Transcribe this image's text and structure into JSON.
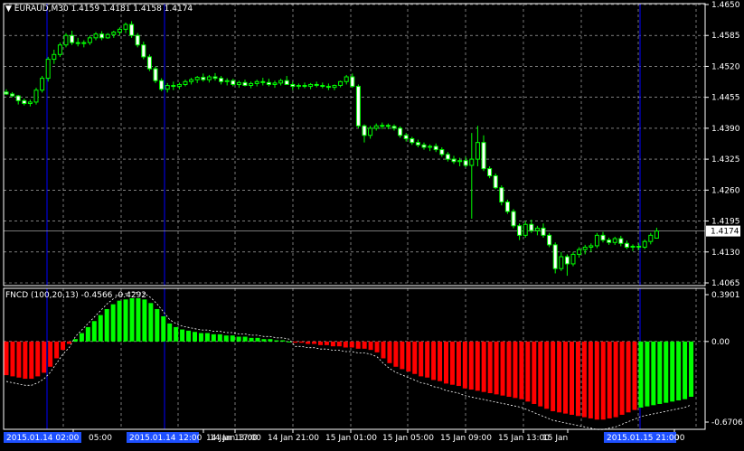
{
  "main_panel": {
    "symbol": "EURAUD,M30",
    "ohlc": "1.4159 1.4181 1.4158 1.4174",
    "current_price": "1.4174",
    "price_ticks": [
      "1.4650",
      "1.4585",
      "1.4520",
      "1.4455",
      "1.4390",
      "1.4325",
      "1.4260",
      "1.4195",
      "1.4130",
      "1.4065"
    ]
  },
  "indicator_panel": {
    "title": "FNCD (100,20,13) -0.4566 -0.4292",
    "ticks": [
      "0.3901",
      "0.00",
      "-0.6706"
    ]
  },
  "time_axis": {
    "labels": [
      "14 Jan 05:00",
      "14 Jan 13:00",
      "14 Jan 17:00",
      "14 Jan 21:00",
      "15 Jan 01:00",
      "15 Jan 05:00",
      "15 Jan 09:00",
      "15 Jan 13:00",
      "15 Jan",
      "00"
    ],
    "highlighted_labels": [
      "2015.01.14 02:00",
      "2015.01.14 12:00",
      "2015.01.15 21:00"
    ]
  },
  "colors": {
    "bull": "#00ff00",
    "bear": "#ff0000",
    "grid": "#c8c8c8",
    "vline": "#0000ff",
    "hilite": "#1e50ff"
  },
  "chart_data": [
    {
      "type": "candlestick",
      "title": "EURAUD,M30",
      "ylim": [
        1.4065,
        1.465
      ],
      "x": [
        "",
        "",
        "",
        "",
        "",
        "",
        "",
        "",
        "",
        "",
        "",
        "",
        "",
        "",
        "",
        "",
        "",
        "",
        "",
        "",
        "",
        "",
        "",
        "",
        "",
        "",
        "",
        "",
        "",
        "",
        "",
        "",
        "",
        "",
        "",
        "",
        "",
        "",
        "",
        "",
        "",
        "",
        "",
        "",
        "",
        "",
        "",
        "",
        "",
        "",
        "",
        "",
        "",
        "",
        "",
        "",
        "",
        "",
        "",
        "",
        "",
        "",
        "",
        "",
        "",
        "",
        "",
        "",
        "",
        "",
        "",
        "",
        "",
        "",
        "",
        "",
        "",
        "",
        "",
        "",
        "",
        "",
        "",
        "",
        "",
        "",
        "",
        "",
        "",
        "",
        "",
        "",
        "",
        "",
        "",
        "",
        "",
        "",
        "",
        "",
        "",
        "",
        "",
        "",
        "",
        "",
        "",
        "",
        "",
        "",
        "",
        "",
        "",
        "",
        "",
        "",
        "",
        "",
        "",
        "",
        "",
        "",
        "",
        "",
        "",
        "",
        "",
        "",
        ""
      ],
      "ohlc": [
        [
          1.4466,
          1.4472,
          1.446,
          1.4462
        ],
        [
          1.4462,
          1.4466,
          1.4455,
          1.4458
        ],
        [
          1.4458,
          1.446,
          1.444,
          1.4448
        ],
        [
          1.4448,
          1.4452,
          1.4438,
          1.4442
        ],
        [
          1.4442,
          1.445,
          1.4436,
          1.4445
        ],
        [
          1.4445,
          1.4475,
          1.444,
          1.447
        ],
        [
          1.447,
          1.45,
          1.4465,
          1.4495
        ],
        [
          1.4495,
          1.454,
          1.4488,
          1.4535
        ],
        [
          1.4535,
          1.4555,
          1.4525,
          1.4545
        ],
        [
          1.4545,
          1.457,
          1.454,
          1.4565
        ],
        [
          1.4565,
          1.459,
          1.456,
          1.4585
        ],
        [
          1.4585,
          1.4595,
          1.4565,
          1.457
        ],
        [
          1.457,
          1.458,
          1.4562,
          1.4568
        ],
        [
          1.4568,
          1.4575,
          1.456,
          1.457
        ],
        [
          1.457,
          1.4585,
          1.4565,
          1.458
        ],
        [
          1.458,
          1.4592,
          1.4575,
          1.4588
        ],
        [
          1.4588,
          1.4594,
          1.4575,
          1.458
        ],
        [
          1.458,
          1.459,
          1.4578,
          1.4587
        ],
        [
          1.4587,
          1.4595,
          1.458,
          1.4592
        ],
        [
          1.4592,
          1.4602,
          1.4585,
          1.4598
        ],
        [
          1.4598,
          1.4612,
          1.459,
          1.4608
        ],
        [
          1.4608,
          1.4615,
          1.458,
          1.4585
        ],
        [
          1.4585,
          1.459,
          1.456,
          1.4565
        ],
        [
          1.4565,
          1.4572,
          1.4535,
          1.454
        ],
        [
          1.454,
          1.4545,
          1.451,
          1.4515
        ],
        [
          1.4515,
          1.452,
          1.4485,
          1.449
        ],
        [
          1.449,
          1.4495,
          1.4468,
          1.4472
        ],
        [
          1.4472,
          1.4485,
          1.4465,
          1.448
        ],
        [
          1.448,
          1.4488,
          1.447,
          1.4478
        ],
        [
          1.4478,
          1.4486,
          1.4472,
          1.4482
        ],
        [
          1.4482,
          1.4492,
          1.4478,
          1.4488
        ],
        [
          1.4488,
          1.4496,
          1.4482,
          1.4492
        ],
        [
          1.4492,
          1.45,
          1.4485,
          1.4497
        ],
        [
          1.4497,
          1.4505,
          1.4488,
          1.4492
        ],
        [
          1.4492,
          1.4502,
          1.4486,
          1.4498
        ],
        [
          1.4498,
          1.4506,
          1.449,
          1.4495
        ],
        [
          1.4495,
          1.45,
          1.4482,
          1.4488
        ],
        [
          1.4488,
          1.4495,
          1.448,
          1.449
        ],
        [
          1.449,
          1.4494,
          1.4478,
          1.4482
        ],
        [
          1.4482,
          1.449,
          1.4475,
          1.4486
        ],
        [
          1.4486,
          1.4492,
          1.4478,
          1.448
        ],
        [
          1.448,
          1.4488,
          1.4474,
          1.4484
        ],
        [
          1.4484,
          1.4492,
          1.4478,
          1.4488
        ],
        [
          1.4488,
          1.4496,
          1.448,
          1.4486
        ],
        [
          1.4486,
          1.4494,
          1.4478,
          1.4482
        ],
        [
          1.4482,
          1.449,
          1.4475,
          1.4485
        ],
        [
          1.4485,
          1.4494,
          1.448,
          1.449
        ],
        [
          1.449,
          1.45,
          1.4484,
          1.4482
        ],
        [
          1.4482,
          1.4488,
          1.447,
          1.4478
        ],
        [
          1.4478,
          1.4484,
          1.4472,
          1.448
        ],
        [
          1.448,
          1.4486,
          1.4474,
          1.4478
        ],
        [
          1.4478,
          1.4485,
          1.4472,
          1.4482
        ],
        [
          1.4482,
          1.4488,
          1.4476,
          1.448
        ],
        [
          1.448,
          1.4486,
          1.4474,
          1.4478
        ],
        [
          1.4478,
          1.4484,
          1.447,
          1.4476
        ],
        [
          1.4476,
          1.4482,
          1.447,
          1.448
        ],
        [
          1.448,
          1.449,
          1.4476,
          1.4488
        ],
        [
          1.4488,
          1.4502,
          1.4482,
          1.4498
        ],
        [
          1.4498,
          1.4505,
          1.4475,
          1.4478
        ],
        [
          1.4478,
          1.4482,
          1.439,
          1.4395
        ],
        [
          1.4395,
          1.4398,
          1.436,
          1.4375
        ],
        [
          1.4375,
          1.4395,
          1.4368,
          1.439
        ],
        [
          1.439,
          1.44,
          1.4385,
          1.4395
        ],
        [
          1.4395,
          1.4402,
          1.4388,
          1.4396
        ],
        [
          1.4396,
          1.44,
          1.4388,
          1.4394
        ],
        [
          1.4394,
          1.4398,
          1.4385,
          1.439
        ],
        [
          1.439,
          1.4394,
          1.437,
          1.4375
        ],
        [
          1.4375,
          1.438,
          1.4362,
          1.4368
        ],
        [
          1.4368,
          1.4372,
          1.4355,
          1.436
        ],
        [
          1.436,
          1.4366,
          1.435,
          1.4355
        ],
        [
          1.4355,
          1.436,
          1.4345,
          1.435
        ],
        [
          1.435,
          1.4356,
          1.4342,
          1.4352
        ],
        [
          1.4352,
          1.4358,
          1.434,
          1.4345
        ],
        [
          1.4345,
          1.435,
          1.433,
          1.4335
        ],
        [
          1.4335,
          1.434,
          1.432,
          1.4325
        ],
        [
          1.4325,
          1.4332,
          1.4315,
          1.432
        ],
        [
          1.432,
          1.4328,
          1.431,
          1.4322
        ],
        [
          1.4322,
          1.433,
          1.4308,
          1.4312
        ],
        [
          1.4312,
          1.438,
          1.42,
          1.4325
        ],
        [
          1.4325,
          1.4395,
          1.431,
          1.436
        ],
        [
          1.436,
          1.4375,
          1.43,
          1.4305
        ],
        [
          1.4305,
          1.431,
          1.4285,
          1.429
        ],
        [
          1.429,
          1.4295,
          1.4262,
          1.4265
        ],
        [
          1.4265,
          1.427,
          1.4228,
          1.4235
        ],
        [
          1.4235,
          1.424,
          1.421,
          1.4215
        ],
        [
          1.4215,
          1.422,
          1.418,
          1.4185
        ],
        [
          1.4185,
          1.419,
          1.4155,
          1.4165
        ],
        [
          1.4165,
          1.4195,
          1.416,
          1.4188
        ],
        [
          1.4188,
          1.4198,
          1.417,
          1.4175
        ],
        [
          1.4175,
          1.4185,
          1.4165,
          1.418
        ],
        [
          1.418,
          1.419,
          1.416,
          1.4165
        ],
        [
          1.4165,
          1.417,
          1.414,
          1.4145
        ],
        [
          1.4145,
          1.415,
          1.4085,
          1.4095
        ],
        [
          1.4095,
          1.413,
          1.409,
          1.412
        ],
        [
          1.412,
          1.4125,
          1.408,
          1.4105
        ],
        [
          1.4105,
          1.413,
          1.41,
          1.4125
        ],
        [
          1.4125,
          1.414,
          1.4118,
          1.4135
        ],
        [
          1.4135,
          1.4145,
          1.4125,
          1.414
        ],
        [
          1.414,
          1.4148,
          1.413,
          1.4143
        ],
        [
          1.4143,
          1.417,
          1.4138,
          1.4165
        ],
        [
          1.4165,
          1.4172,
          1.415,
          1.4155
        ],
        [
          1.4155,
          1.416,
          1.4145,
          1.415
        ],
        [
          1.415,
          1.4162,
          1.4145,
          1.4158
        ],
        [
          1.4158,
          1.4164,
          1.4142,
          1.4148
        ],
        [
          1.4148,
          1.4154,
          1.4136,
          1.414
        ],
        [
          1.414,
          1.4146,
          1.4132,
          1.4142
        ],
        [
          1.4142,
          1.4148,
          1.4134,
          1.414
        ],
        [
          1.414,
          1.4156,
          1.4136,
          1.4152
        ],
        [
          1.4152,
          1.417,
          1.4146,
          1.4165
        ],
        [
          1.4159,
          1.4181,
          1.4158,
          1.4174
        ]
      ]
    },
    {
      "type": "bar",
      "title": "FNCD (100,20,13) -0.4566 -0.4292",
      "ylim": [
        -0.6706,
        0.3901
      ],
      "series": [
        {
          "values": [
            -0.28,
            -0.29,
            -0.3,
            -0.31,
            -0.31,
            -0.29,
            -0.26,
            -0.21,
            -0.14,
            -0.07,
            -0.02,
            0.02,
            0.07,
            0.12,
            0.17,
            0.22,
            0.27,
            0.31,
            0.34,
            0.35,
            0.36,
            0.36,
            0.35,
            0.32,
            0.27,
            0.21,
            0.15,
            0.12,
            0.1,
            0.09,
            0.08,
            0.07,
            0.07,
            0.06,
            0.06,
            0.05,
            0.05,
            0.04,
            0.04,
            0.03,
            0.03,
            0.02,
            0.02,
            0.01,
            0.01,
            0.0,
            -0.01,
            -0.01,
            -0.02,
            -0.02,
            -0.03,
            -0.03,
            -0.04,
            -0.04,
            -0.05,
            -0.05,
            -0.06,
            -0.06,
            -0.07,
            -0.09,
            -0.14,
            -0.18,
            -0.21,
            -0.23,
            -0.25,
            -0.27,
            -0.29,
            -0.3,
            -0.32,
            -0.33,
            -0.35,
            -0.36,
            -0.37,
            -0.39,
            -0.4,
            -0.41,
            -0.42,
            -0.43,
            -0.44,
            -0.45,
            -0.46,
            -0.47,
            -0.48,
            -0.5,
            -0.52,
            -0.54,
            -0.56,
            -0.58,
            -0.59,
            -0.6,
            -0.61,
            -0.62,
            -0.63,
            -0.64,
            -0.65,
            -0.65,
            -0.64,
            -0.63,
            -0.61,
            -0.59,
            -0.57,
            -0.55,
            -0.54,
            -0.53,
            -0.52,
            -0.51,
            -0.5,
            -0.49,
            -0.48,
            -0.46
          ]
        }
      ]
    }
  ]
}
